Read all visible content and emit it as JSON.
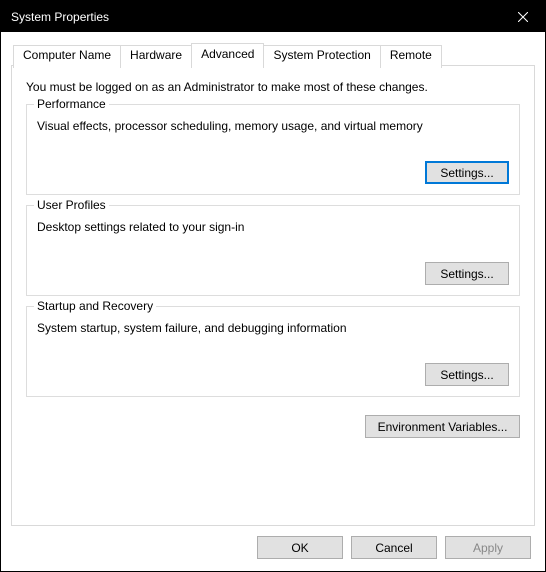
{
  "title": "System Properties",
  "tabs": [
    {
      "label": "Computer Name",
      "active": false
    },
    {
      "label": "Hardware",
      "active": false
    },
    {
      "label": "Advanced",
      "active": true
    },
    {
      "label": "System Protection",
      "active": false
    },
    {
      "label": "Remote",
      "active": false
    }
  ],
  "intro": "You must be logged on as an Administrator to make most of these changes.",
  "groups": {
    "performance": {
      "title": "Performance",
      "desc": "Visual effects, processor scheduling, memory usage, and virtual memory",
      "button": "Settings..."
    },
    "profiles": {
      "title": "User Profiles",
      "desc": "Desktop settings related to your sign-in",
      "button": "Settings..."
    },
    "startup": {
      "title": "Startup and Recovery",
      "desc": "System startup, system failure, and debugging information",
      "button": "Settings..."
    }
  },
  "env_button": "Environment Variables...",
  "footer": {
    "ok": "OK",
    "cancel": "Cancel",
    "apply": "Apply"
  }
}
